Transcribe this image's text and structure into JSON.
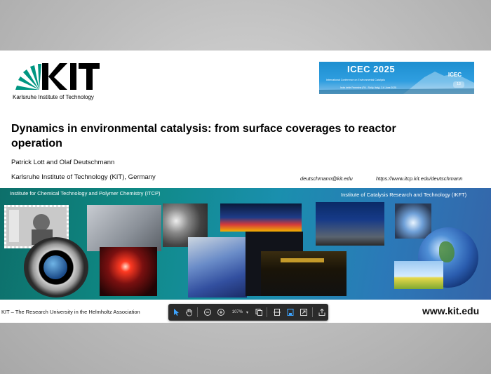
{
  "slide": {
    "title": "Dynamics in environmental catalysis: from surface coverages to reactor operation",
    "authors": "Patrick Lott and Olaf Deutschmann",
    "affiliation": "Karlsruhe Institute of Technology (KIT), Germany",
    "email": "deutschmann@kit.edu",
    "url": "https://www.itcp.kit.edu/deutschmann",
    "logo_text": "KIT",
    "logo_subtitle": "Karlsruhe Institute of Technology",
    "conference_title": "ICEC 2025",
    "conference_subtitle": "International Conference on Environmental Catalysis",
    "conference_place": "Isola delle Femmine (PA - Sicily, Italy), 2-6 June 2025",
    "conference_mark": "ICEC",
    "conference_number": "13",
    "band_left_label": "Institute for Chemical Technology and Polymer  Chemistry (ITCP)",
    "band_right_label": "Institute of Catalysis Research and Technology (IKFT)",
    "footer_left": "KIT – The Research University in the Helmholtz Association",
    "footer_right": "www.kit.edu"
  },
  "toolbar": {
    "zoom": "107%",
    "tools": [
      "select-cursor",
      "hand-pan",
      "zoom-out",
      "zoom-in",
      "zoom-dropdown",
      "copy",
      "fit-width",
      "save",
      "fullscreen",
      "share"
    ]
  },
  "colors": {
    "band_teal": "#0f8a86",
    "band_blue": "#2b79b8",
    "kit_green": "#009682",
    "toolbar_bg": "#2b2b2b",
    "icec_blue": "#1d8fd0"
  }
}
